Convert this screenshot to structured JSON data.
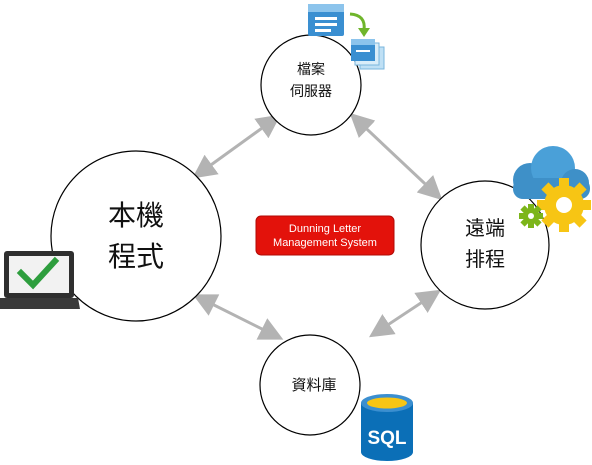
{
  "nodes": {
    "file_server": {
      "line1": "檔案",
      "line2": "伺服器"
    },
    "local_program": {
      "line1": "本機",
      "line2": "程式"
    },
    "remote_scheduler": {
      "line1": "遠端",
      "line2": "排程"
    },
    "database": {
      "line1": "資料庫"
    }
  },
  "center_box": {
    "line1": "Dunning Letter",
    "line2": "Management System"
  },
  "icons": {
    "file_server": "file-transfer-icon",
    "local_program": "laptop-check-icon",
    "remote_scheduler": "cloud-gears-icon",
    "database": "sql-database-icon"
  },
  "sql_icon_text": "SQL",
  "colors": {
    "center_box_fill": "#e3120b",
    "arrow": "#b3b3b3",
    "check": "#2e9e3e",
    "cloud": "#3e90c8",
    "gear_yellow": "#f7c514",
    "gear_green": "#7cb51a",
    "sql_blue": "#0b6fb7"
  }
}
